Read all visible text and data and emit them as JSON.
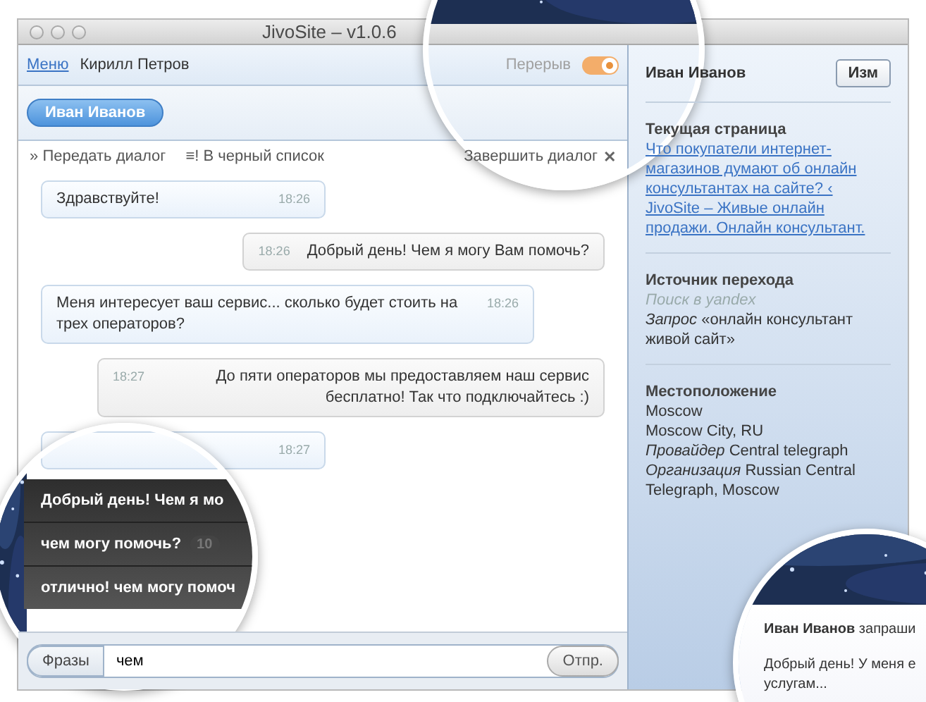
{
  "window": {
    "title": "JivoSite – v1.0.6"
  },
  "header": {
    "menu_link": "Меню",
    "operator": "Кирилл Петров",
    "break_label": "Перерыв",
    "break_on": true
  },
  "tabs": [
    {
      "label": "Иван Иванов",
      "selected": true
    }
  ],
  "toolbar": {
    "actions": [
      {
        "icon": "»",
        "label": "Передать диалог"
      },
      {
        "icon": "≡!",
        "label": "В черный список"
      }
    ],
    "end_action": {
      "label": "Завершить диалог",
      "icon": "✕"
    }
  },
  "messages": [
    {
      "kind": "in",
      "text": "Здравствуйте!",
      "time": "18:26"
    },
    {
      "kind": "out",
      "text": "Добрый день! Чем я могу Вам помочь?",
      "time": "18:26"
    },
    {
      "kind": "in",
      "text": "Меня интересует ваш сервис... сколько будет стоить на трех операторов?",
      "time": "18:26"
    },
    {
      "kind": "out",
      "text": "До пяти операторов мы предоставляем наш сервис бесплатно! Так что подключайтесь :)",
      "time": "18:27"
    },
    {
      "kind": "in",
      "time": "18:27"
    }
  ],
  "phrases_popup": {
    "items": [
      {
        "text": "Добрый день! Чем я мо"
      },
      {
        "text": "чем могу помочь?",
        "count": "10"
      },
      {
        "text": "отлично! чем могу помоч"
      }
    ]
  },
  "composer": {
    "phrases_button": "Фразы",
    "value": "чем",
    "send_button": "Отпр."
  },
  "sidebar": {
    "visitor_name": "Иван Иванов",
    "edit_button": "Изм",
    "sections": [
      {
        "title": "Текущая страница",
        "lines": [
          {
            "kind": "link",
            "text": "Что покупатели интернет-магазинов думают об онлайн консультантах на сайте? ‹ JivoSite – Живые онлайн продажи. Онлайн консультант."
          }
        ]
      },
      {
        "title": "Источник перехода",
        "lines": [
          {
            "kind": "note",
            "text": "Поиск в yandex"
          },
          {
            "kind": "text",
            "text": "*Запрос* «онлайн консультант живой сайт»"
          }
        ]
      },
      {
        "title": "Местоположение",
        "lines": [
          {
            "kind": "text",
            "text": "Moscow"
          },
          {
            "kind": "text",
            "text": "Moscow City, RU"
          },
          {
            "kind": "text",
            "text": "*Провайдер* Central telegraph"
          },
          {
            "kind": "text",
            "text": "*Организация* Russian Central Telegraph, Moscow"
          }
        ]
      }
    ]
  },
  "notification": {
    "title": "**Иван Иванов** запраши",
    "lines": [
      "Добрый день! У меня е",
      "услугам..."
    ]
  }
}
